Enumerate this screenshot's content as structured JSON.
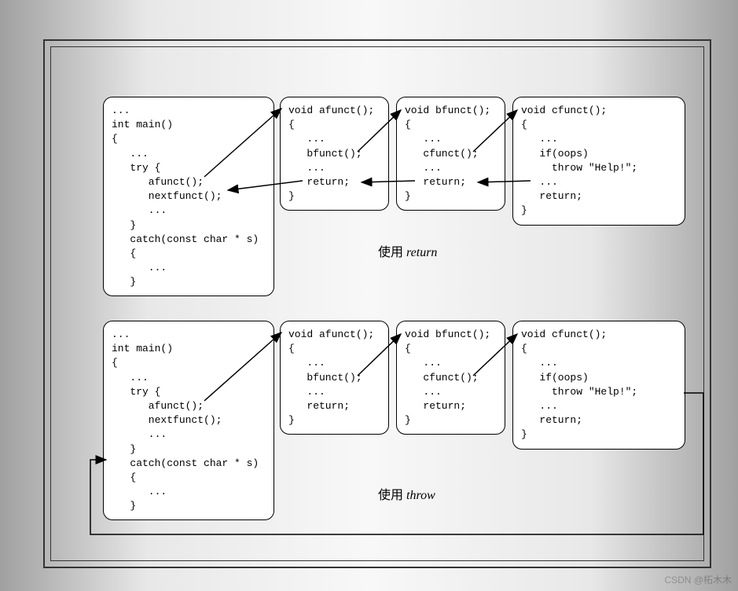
{
  "watermark": "CSDN @柘木木",
  "caption_return_prefix": "使用 ",
  "caption_return_italic": "return",
  "caption_throw_prefix": "使用 ",
  "caption_throw_italic": "throw",
  "top": {
    "main": "...\nint main()\n{\n   ...\n   try {\n      afunct();\n      nextfunct();\n      ...\n   }\n   catch(const char * s)\n   {\n      ...\n   }",
    "afunc": "void afunct();\n{\n   ...\n   bfunct();\n   ...\n   return;\n}",
    "bfunc": "void bfunct();\n{\n   ...\n   cfunct();\n   ...\n   return;\n}",
    "cfunc": "void cfunct();\n{\n   ...\n   if(oops)\n     throw \"Help!\";\n   ...\n   return;\n}"
  },
  "bottom": {
    "main": "...\nint main()\n{\n   ...\n   try {\n      afunct();\n      nextfunct();\n      ...\n   }\n   catch(const char * s)\n   {\n      ...\n   }",
    "afunc": "void afunct();\n{\n   ...\n   bfunct();\n   ...\n   return;\n}",
    "bfunc": "void bfunct();\n{\n   ...\n   cfunct();\n   ...\n   return;\n}",
    "cfunc": "void cfunct();\n{\n   ...\n   if(oops)\n     throw \"Help!\";\n   ...\n   return;\n}"
  }
}
